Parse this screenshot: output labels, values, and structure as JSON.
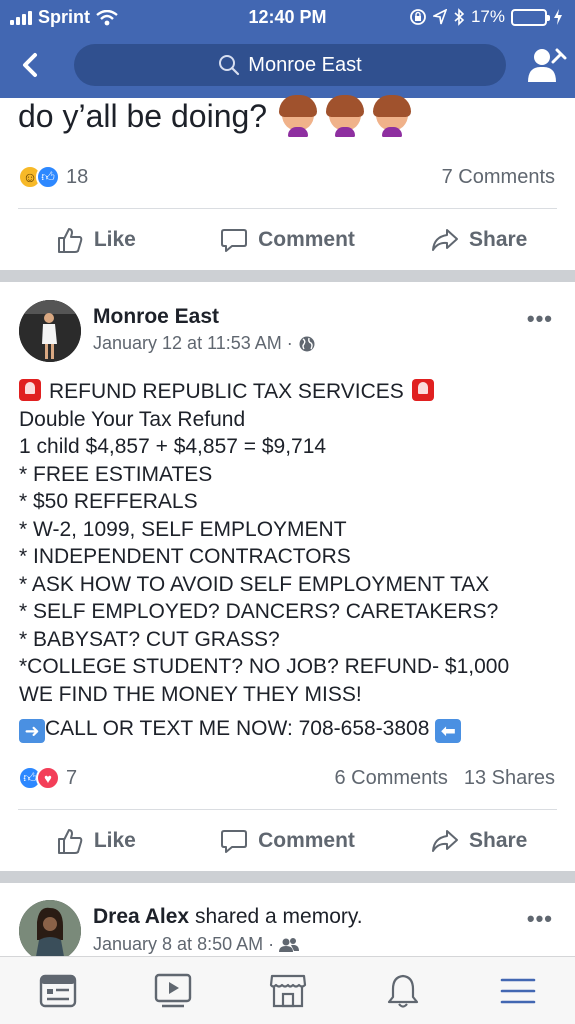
{
  "status_bar": {
    "carrier": "Sprint",
    "time": "12:40 PM",
    "battery": "17%",
    "battery_level": 0.17
  },
  "header": {
    "search_text": "Monroe East"
  },
  "post1": {
    "text_tail": "do y’all be doing?",
    "reactions_count": "18",
    "comments": "7 Comments"
  },
  "actions": {
    "like": "Like",
    "comment": "Comment",
    "share": "Share"
  },
  "post2": {
    "author": "Monroe East",
    "timestamp": "January 12 at 11:53 AM",
    "lines": {
      "headline": "REFUND REPUBLIC TAX SERVICES",
      "l1": "Double Your Tax Refund",
      "l2": "1 child $4,857 + $4,857 = $9,714",
      "l3": "* FREE ESTIMATES",
      "l4": "* $50 REFFERALS",
      "l5": "* W-2, 1099, SELF EMPLOYMENT",
      "l6": "* INDEPENDENT CONTRACTORS",
      "l7": "* ASK HOW TO AVOID SELF EMPLOYMENT TAX",
      "l8": "* SELF EMPLOYED? DANCERS? CARETAKERS?",
      "l9": "* BABYSAT? CUT GRASS?",
      "l10": "*COLLEGE STUDENT? NO JOB? REFUND- $1,000",
      "l11": "WE FIND THE MONEY THEY MISS!",
      "cta": "CALL OR TEXT ME NOW: 708-658-3808"
    },
    "reactions_count": "7",
    "comments": "6 Comments",
    "shares": "13 Shares"
  },
  "post3": {
    "author": "Drea Alex",
    "action": "shared a memory.",
    "timestamp": "January 8 at 8:50 AM"
  },
  "icons": {
    "tabs": [
      "news-feed-icon",
      "watch-icon",
      "marketplace-icon",
      "notifications-icon",
      "menu-icon"
    ]
  },
  "colors": {
    "brand": "#4267b2",
    "like_blue": "#2d88ff",
    "love_red": "#f33e58",
    "text": "#1d2129",
    "secondary": "#606770"
  }
}
